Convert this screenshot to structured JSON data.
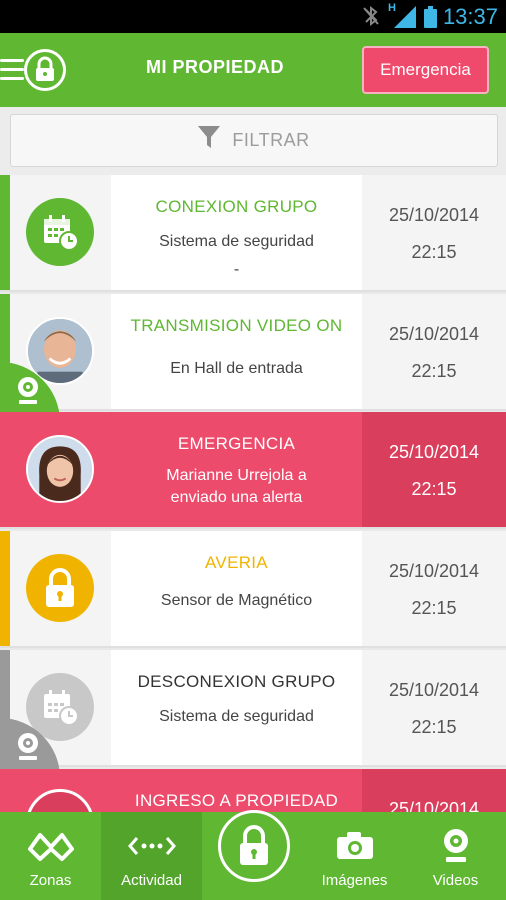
{
  "status_bar": {
    "time": "13:37",
    "network": "H"
  },
  "header": {
    "title": "MI PROPIEDAD",
    "emergency_button": "Emergencia"
  },
  "filter": {
    "label": "FILTRAR"
  },
  "activities": [
    {
      "title": "CONEXION GRUPO",
      "desc": "Sistema de seguridad",
      "extra": "-",
      "date": "25/10/2014",
      "time": "22:15",
      "title_color": "#5fb732",
      "accent_color": "#5fb732",
      "icon": "calendar-clock-icon"
    },
    {
      "title": "TRANSMISION VIDEO ON",
      "desc": "En Hall de entrada",
      "date": "25/10/2014",
      "time": "22:15",
      "title_color": "#5fb732",
      "accent_color": "#5fb732",
      "icon": "man-avatar"
    },
    {
      "title": "EMERGENCIA",
      "desc_line1": "Marianne Urrejola a",
      "desc_line2": "enviado una alerta",
      "date": "25/10/2014",
      "time": "22:15",
      "accent_color": "#ed4b6c",
      "icon": "woman-avatar"
    },
    {
      "title": "AVERIA",
      "desc": "Sensor de Magnético",
      "date": "25/10/2014",
      "time": "22:15",
      "title_color": "#f0b400",
      "accent_color": "#f0b400",
      "icon": "padlock-icon"
    },
    {
      "title": "DESCONEXION GRUPO",
      "desc": "Sistema de seguridad",
      "date": "25/10/2014",
      "time": "22:15",
      "title_color": "#333333",
      "accent_color": "#9a9a9a",
      "icon": "calendar-clock-icon"
    },
    {
      "title": "INGRESO A PROPIEDAD",
      "date": "25/10/2014",
      "accent_color": "#ed4b6c"
    }
  ],
  "nav": {
    "zonas": "Zonas",
    "actividad": "Actividad",
    "imagenes": "Imágenes",
    "videos": "Videos"
  },
  "colors": {
    "brand_green": "#5fb732",
    "alert_pink": "#ed4b6c",
    "warning_yellow": "#f0b400"
  }
}
